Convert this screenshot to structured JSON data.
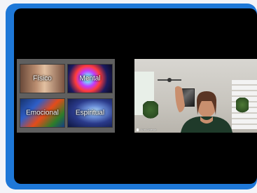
{
  "slide": {
    "quadrants": [
      {
        "label": "Físico"
      },
      {
        "label": "Mental"
      },
      {
        "label": "Emocional"
      },
      {
        "label": "Espiritual"
      }
    ]
  },
  "camera": {
    "participant_label": "Ana Almeida"
  },
  "icons": [
    "microphone-icon"
  ],
  "colors": {
    "frame": "#1e78d8",
    "screen": "#000000"
  }
}
